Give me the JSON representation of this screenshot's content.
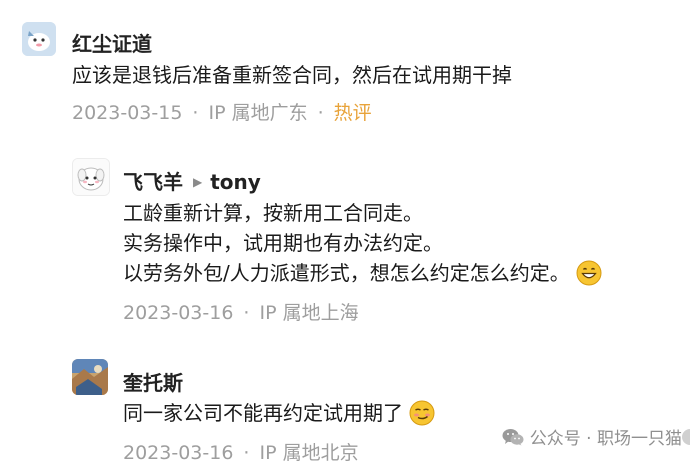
{
  "comments": [
    {
      "user": "红尘证道",
      "text_lines": [
        "应该是退钱后准备重新签合同，然后在试用期干掉"
      ],
      "date": "2023-03-15",
      "location": "IP 属地广东",
      "hot_label": "热评",
      "separator": "·"
    },
    {
      "user": "飞飞羊",
      "reply_to": "tony",
      "text_lines": [
        "工龄重新计算，按新用工合同走。",
        "实务操作中，试用期也有办法约定。",
        "以劳务外包/人力派遣形式，想怎么约定怎么约定。"
      ],
      "date": "2023-03-16",
      "location": "IP 属地上海",
      "separator": "·"
    },
    {
      "user": "奎托斯",
      "text_lines": [
        "同一家公司不能再约定试用期了"
      ],
      "date": "2023-03-16",
      "location": "IP 属地北京",
      "separator": "·"
    }
  ],
  "watermark": {
    "text": "公众号 · 职场一只猫",
    "icon": "wechat-icon"
  },
  "colors": {
    "hot": "#e8a33a",
    "meta": "#9e9e9e",
    "name": "#222222"
  },
  "icons": {
    "reply_arrow": "triangle-right-icon",
    "emoji_grin": "grinning-face-icon",
    "emoji_smirk": "smirking-face-icon"
  }
}
